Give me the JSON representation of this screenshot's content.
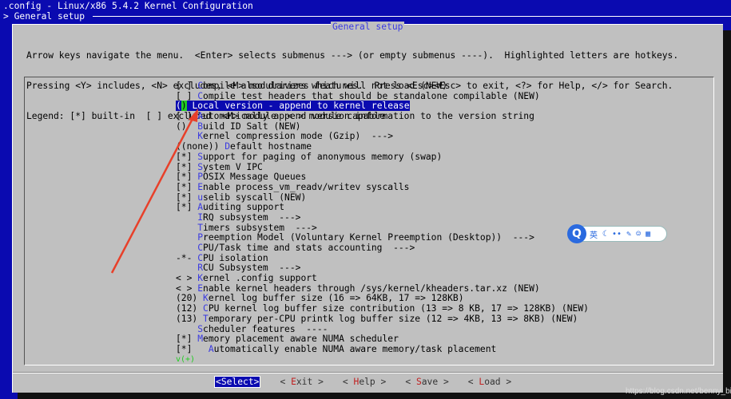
{
  "window": {
    "title": ".config - Linux/x86 5.4.2 Kernel Configuration",
    "breadcrumb": "> General setup"
  },
  "dialog": {
    "title": "General setup",
    "help": [
      "Arrow keys navigate the menu.  <Enter> selects submenus ---> (or empty submenus ----).  Highlighted letters are hotkeys.",
      "Pressing <Y> includes, <N> excludes, <M> modularizes features.  Press <Esc><Esc> to exit, <?> for Help, </> for Search.",
      "Legend: [*] built-in  [ ] excluded  <M> module  < > module capable"
    ]
  },
  "menu": {
    "selected_index": 2,
    "more_indicator": "v(+)",
    "items": [
      {
        "p": "[ ] ",
        "h": "C",
        "r": "ompile also drivers which will not load (NEW)"
      },
      {
        "p": "[ ] ",
        "h": "C",
        "r": "ompile test headers that should be standalone compilable (NEW)"
      },
      {
        "p": "() ",
        "h": "L",
        "r": "ocal version - append to kernel release"
      },
      {
        "p": "[ ] ",
        "h": "A",
        "r": "utomatically append version information to the version string"
      },
      {
        "p": "()  ",
        "h": "B",
        "r": "uild ID Salt (NEW)"
      },
      {
        "p": "    ",
        "h": "K",
        "r": "ernel compression mode (Gzip)  --->"
      },
      {
        "p": "((none)) ",
        "h": "D",
        "r": "efault hostname"
      },
      {
        "p": "[*] ",
        "h": "S",
        "r": "upport for paging of anonymous memory (swap)"
      },
      {
        "p": "[*] ",
        "h": "S",
        "r": "ystem V IPC"
      },
      {
        "p": "[*] ",
        "h": "P",
        "r": "OSIX Message Queues"
      },
      {
        "p": "[*] ",
        "h": "E",
        "r": "nable process_vm_readv/writev syscalls"
      },
      {
        "p": "[*] ",
        "h": "u",
        "r": "selib syscall (NEW)"
      },
      {
        "p": "[*] ",
        "h": "A",
        "r": "uditing support"
      },
      {
        "p": "    ",
        "h": "I",
        "r": "RQ subsystem  --->"
      },
      {
        "p": "    ",
        "h": "T",
        "r": "imers subsystem  --->"
      },
      {
        "p": "    ",
        "h": "P",
        "r": "reemption Model (Voluntary Kernel Preemption (Desktop))  --->"
      },
      {
        "p": "    ",
        "h": "C",
        "r": "PU/Task time and stats accounting  --->"
      },
      {
        "p": "-*- ",
        "h": "C",
        "r": "PU isolation"
      },
      {
        "p": "    ",
        "h": "R",
        "r": "CU Subsystem  --->"
      },
      {
        "p": "< > ",
        "h": "K",
        "r": "ernel .config support"
      },
      {
        "p": "< > ",
        "h": "E",
        "r": "nable kernel headers through /sys/kernel/kheaders.tar.xz (NEW)"
      },
      {
        "p": "(20) ",
        "h": "K",
        "r": "ernel log buffer size (16 => 64KB, 17 => 128KB)"
      },
      {
        "p": "(12) ",
        "h": "C",
        "r": "PU kernel log buffer size contribution (13 => 8 KB, 17 => 128KB) (NEW)"
      },
      {
        "p": "(13) ",
        "h": "T",
        "r": "emporary per-CPU printk log buffer size (12 => 4KB, 13 => 8KB) (NEW)"
      },
      {
        "p": "    ",
        "h": "S",
        "r": "cheduler features  ----"
      },
      {
        "p": "[*] ",
        "h": "M",
        "r": "emory placement aware NUMA scheduler"
      },
      {
        "p": "[*]   ",
        "h": "A",
        "r": "utomatically enable NUMA aware memory/task placement"
      }
    ]
  },
  "buttons": [
    {
      "open": "<",
      "h": "S",
      "r": "elect",
      "close": ">",
      "selected": true
    },
    {
      "open": "< ",
      "h": "E",
      "r": "xit",
      "close": " >"
    },
    {
      "open": "< ",
      "h": "H",
      "r": "elp",
      "close": " >"
    },
    {
      "open": "< ",
      "h": "S",
      "r": "ave",
      "close": " >"
    },
    {
      "open": "< ",
      "h": "L",
      "r": "oad",
      "close": " >"
    }
  ],
  "ime": {
    "logo": "Q",
    "lang": "英",
    "icons": [
      "moon-icon",
      "punctuation-icon",
      "wrench-icon",
      "emoji-icon",
      "grid-icon"
    ]
  },
  "watermark": "https://blog.csdn.net/benny_bin",
  "colors": {
    "background": "#0a0ab0",
    "dialog": "#c0c0c0",
    "hotkey": "#3a3ae0",
    "button_hotkey": "#c02020",
    "annotation_arrow": "#e8402a"
  }
}
